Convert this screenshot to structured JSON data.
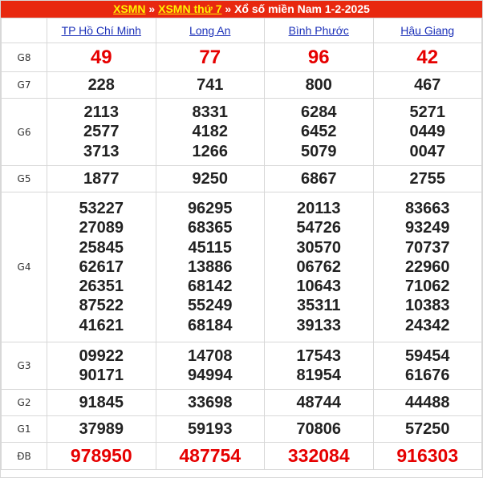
{
  "breadcrumb": {
    "link1": "XSMN",
    "sep1": " » ",
    "link2": "XSMN thứ 7",
    "sep2": " » ",
    "title": "Xổ số miền Nam 1-2-2025"
  },
  "provinces": [
    "TP Hồ Chí Minh",
    "Long An",
    "Bình Phước",
    "Hậu Giang"
  ],
  "prizes": [
    {
      "label": "G8",
      "values": [
        [
          "49"
        ],
        [
          "77"
        ],
        [
          "96"
        ],
        [
          "42"
        ]
      ]
    },
    {
      "label": "G7",
      "values": [
        [
          "228"
        ],
        [
          "741"
        ],
        [
          "800"
        ],
        [
          "467"
        ]
      ]
    },
    {
      "label": "G6",
      "values": [
        [
          "2113",
          "2577",
          "3713"
        ],
        [
          "8331",
          "4182",
          "1266"
        ],
        [
          "6284",
          "6452",
          "5079"
        ],
        [
          "5271",
          "0449",
          "0047"
        ]
      ]
    },
    {
      "label": "G5",
      "values": [
        [
          "1877"
        ],
        [
          "9250"
        ],
        [
          "6867"
        ],
        [
          "2755"
        ]
      ]
    },
    {
      "label": "G4",
      "values": [
        [
          "53227",
          "27089",
          "25845",
          "62617",
          "26351",
          "87522",
          "41621"
        ],
        [
          "96295",
          "68365",
          "45115",
          "13886",
          "68142",
          "55249",
          "68184"
        ],
        [
          "20113",
          "54726",
          "30570",
          "06762",
          "10643",
          "35311",
          "39133"
        ],
        [
          "83663",
          "93249",
          "70737",
          "22960",
          "71062",
          "10383",
          "24342"
        ]
      ]
    },
    {
      "label": "G3",
      "values": [
        [
          "09922",
          "90171"
        ],
        [
          "14708",
          "94994"
        ],
        [
          "17543",
          "81954"
        ],
        [
          "59454",
          "61676"
        ]
      ]
    },
    {
      "label": "G2",
      "values": [
        [
          "91845"
        ],
        [
          "33698"
        ],
        [
          "48744"
        ],
        [
          "44488"
        ]
      ]
    },
    {
      "label": "G1",
      "values": [
        [
          "37989"
        ],
        [
          "59193"
        ],
        [
          "70806"
        ],
        [
          "57250"
        ]
      ]
    },
    {
      "label": "ĐB",
      "values": [
        [
          "978950"
        ],
        [
          "487754"
        ],
        [
          "332084"
        ],
        [
          "916303"
        ]
      ]
    }
  ],
  "colors": {
    "header_bg": "#e8280f",
    "header_link": "#fff200",
    "highlight_number": "#e60000",
    "province_link": "#1a2fb8"
  }
}
